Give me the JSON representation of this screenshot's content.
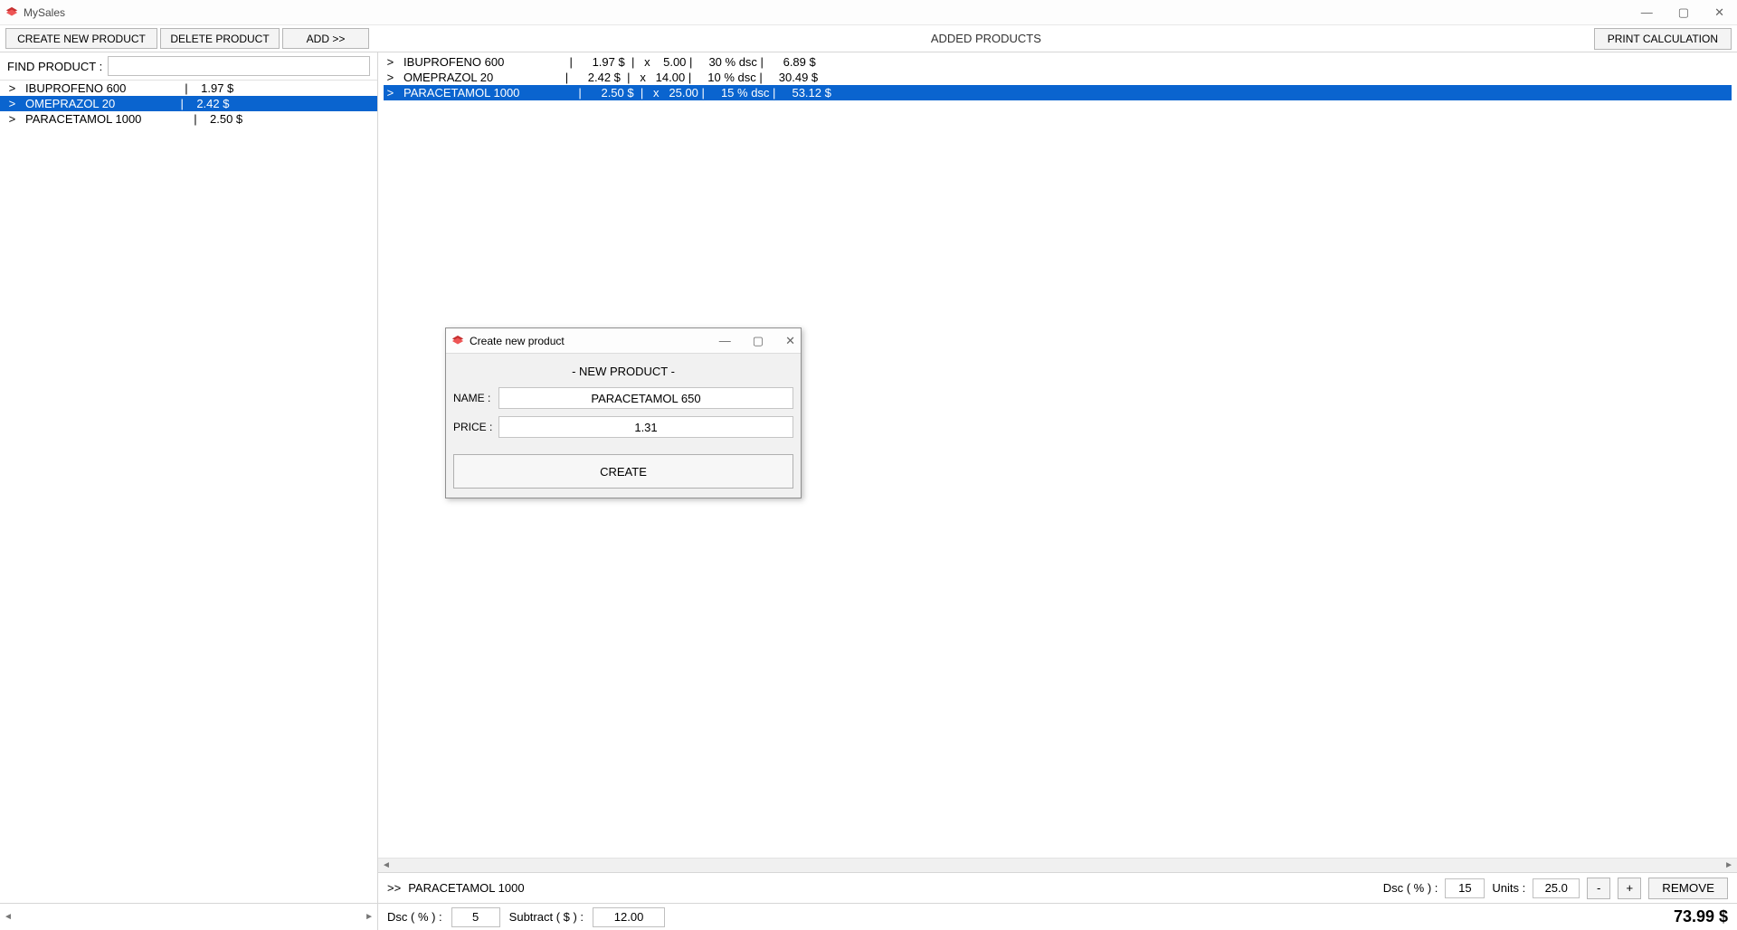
{
  "window": {
    "title": "MySales",
    "min_icon": "—",
    "max_icon": "▢",
    "close_icon": "✕"
  },
  "toolbar": {
    "create_label": "CREATE NEW PRODUCT",
    "delete_label": "DELETE PRODUCT",
    "add_label": "ADD   >>",
    "added_heading": "ADDED PRODUCTS",
    "print_label": "PRINT CALCULATION"
  },
  "find": {
    "label": "FIND PRODUCT :",
    "value": ""
  },
  "product_list": [
    {
      "name": "IBUPROFENO 600",
      "price": "1.97 $",
      "selected": false
    },
    {
      "name": "OMEPRAZOL 20",
      "price": "2.42 $",
      "selected": true
    },
    {
      "name": "PARACETAMOL 1000",
      "price": "2.50 $",
      "selected": false
    }
  ],
  "added_list": [
    {
      "name": "IBUPROFENO 600",
      "price": "1.97 $",
      "qty": "5.00",
      "dsc": "30 % dsc",
      "total": "6.89 $",
      "selected": false
    },
    {
      "name": "OMEPRAZOL 20",
      "price": "2.42 $",
      "qty": "14.00",
      "dsc": "10 % dsc",
      "total": "30.49 $",
      "selected": false
    },
    {
      "name": "PARACETAMOL 1000",
      "price": "2.50 $",
      "qty": "25.00",
      "dsc": "15 % dsc",
      "total": "53.12 $",
      "selected": true
    }
  ],
  "selected_bar": {
    "prefix": ">>",
    "name": "PARACETAMOL 1000",
    "dsc_label": "Dsc ( % ) :",
    "dsc_value": "15",
    "units_label": "Units :",
    "units_value": "25.0",
    "minus": "-",
    "plus": "+",
    "remove_label": "REMOVE"
  },
  "footer": {
    "dsc_label": "Dsc ( % ) :",
    "dsc_value": "5",
    "subtract_label": "Subtract ( $ ) :",
    "subtract_value": "12.00",
    "total": "73.99 $"
  },
  "modal": {
    "title": "Create new product",
    "heading": "- NEW PRODUCT -",
    "name_label": "NAME :",
    "name_value": "PARACETAMOL 650",
    "price_label": "PRICE :",
    "price_value": "1.31",
    "create_label": "CREATE",
    "min_icon": "—",
    "max_icon": "▢",
    "close_icon": "✕"
  }
}
